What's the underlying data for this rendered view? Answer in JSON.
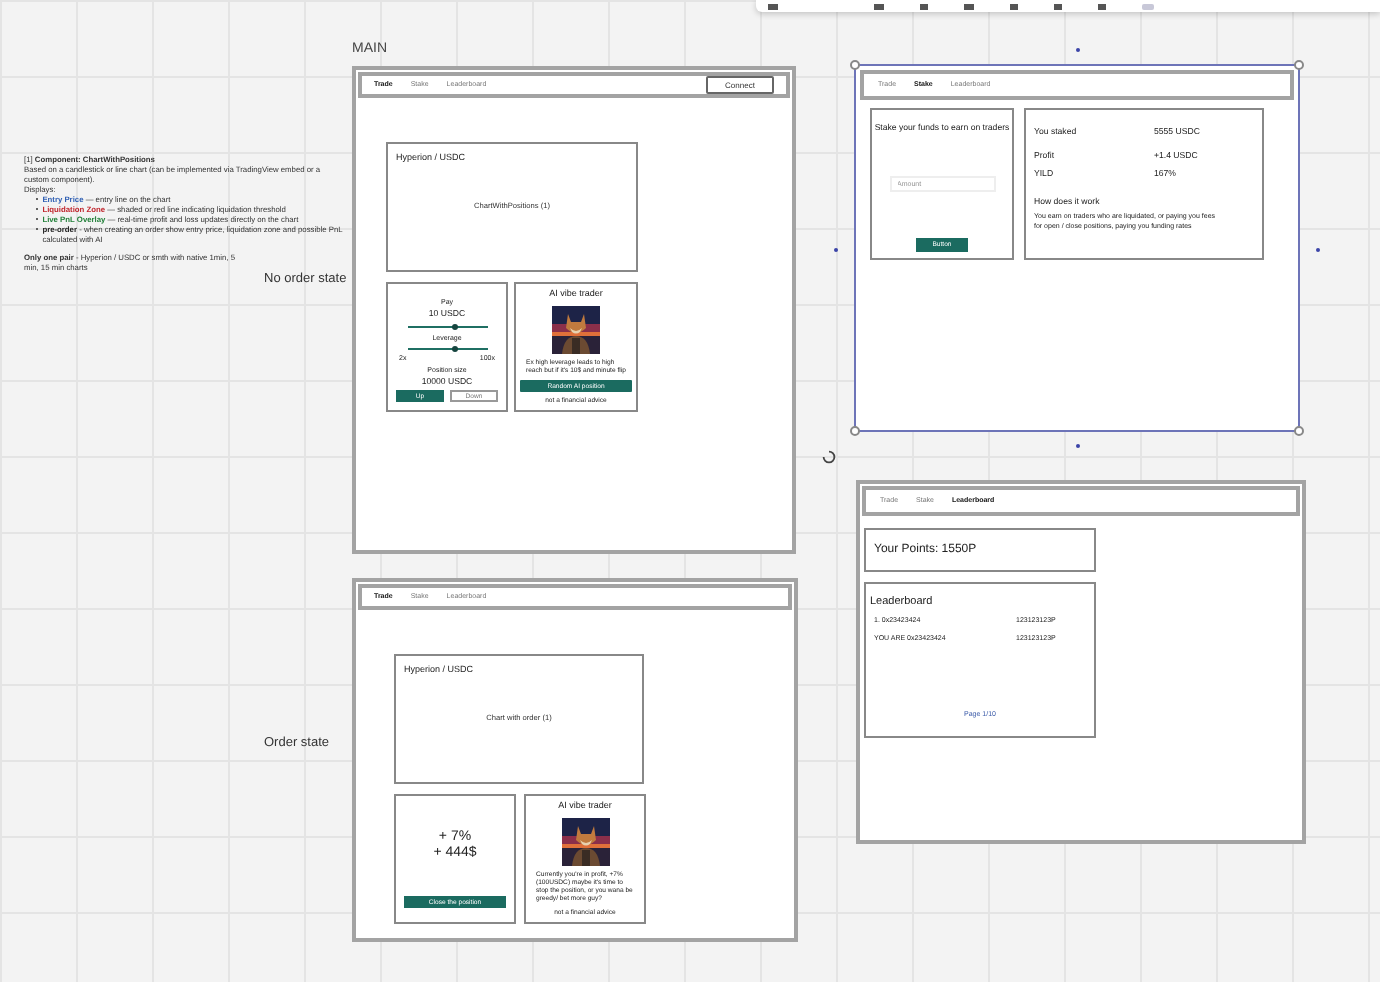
{
  "main_label": "MAIN",
  "notes": {
    "heading": "[1] **Component: ChartWithPositions**",
    "intro": "Based on a candlestick or line chart (can be implemented via TradingView embed or a custom component).",
    "displays_label": "Displays:",
    "bullets": [
      {
        "term": "Entry Price",
        "color": "#2f5fb3",
        "text": " — entry line on the chart"
      },
      {
        "term": "Liquidation Zone",
        "color": "#c0262d",
        "text": " — shaded or red line indicating liquidation threshold"
      },
      {
        "term": "Live PnL Overlay",
        "color": "#23803a",
        "text": " — real-time profit and loss updates directly on the chart"
      },
      {
        "term": "pre-order",
        "color": "#222222",
        "text": " - when creating an order show entry price, liquidation zone and possible PnL calculated with AI"
      }
    ],
    "footer": "**Only one pair** - Hyperion / USDC or smth with native 1min, 5 min, 15 min charts"
  },
  "state_labels": [
    "No order state",
    "Order state"
  ],
  "frames": [
    {
      "kind": "trade",
      "tabs": [
        {
          "label": "Trade",
          "selected": true
        },
        {
          "label": "Stake",
          "selected": false
        },
        {
          "label": "Leaderboard",
          "selected": false
        }
      ],
      "connect": "Connect",
      "chart": {
        "title": "Hyperion / USDC",
        "caption": "ChartWithPositions (1)"
      },
      "trade_panel": {
        "pay_label": "Pay",
        "pay_value": "10 USDC",
        "pay_slider": {
          "level": 0.6
        },
        "leverage_label": "Leverage",
        "leverage_slider": {
          "level": 0.6
        },
        "leverage_min": "2x",
        "leverage_max": "100x",
        "size_label": "Position size",
        "size_value": "10000 USDC",
        "buttons": [
          {
            "label": "Up",
            "kind": "primary"
          },
          {
            "label": "Down",
            "kind": "secondary"
          }
        ]
      },
      "ai": {
        "title": "AI vibe trader",
        "message": "Ex high leverage leads to high reach but if it's 10$ and minute flip",
        "button": "Random AI position",
        "disclaimer": "not a financial advice"
      }
    },
    {
      "kind": "stake",
      "tabs": [
        {
          "label": "Trade",
          "selected": false
        },
        {
          "label": "Stake",
          "selected": true
        },
        {
          "label": "Leaderboard",
          "selected": false
        }
      ],
      "stake_panel": {
        "title": "Stake your funds to earn on traders",
        "placeholder": "Amount",
        "button": "Button"
      },
      "stats": [
        {
          "label": "You staked",
          "value": "5555 USDC"
        },
        {
          "label": "Profit",
          "value": "+1.4 USDC"
        },
        {
          "label": "YILD",
          "value": "167%"
        }
      ],
      "how_title": "How does it work",
      "how_lines": [
        "You earn on traders who are liquidated, or paying you fees",
        "for open / close positions, paying you funding rates"
      ]
    },
    {
      "kind": "leaderboard",
      "tabs": [
        {
          "label": "Trade",
          "selected": false
        },
        {
          "label": "Stake",
          "selected": false
        },
        {
          "label": "Leaderboard",
          "selected": true
        }
      ],
      "points": "Your Points: 1550P",
      "board_title": "Leaderboard",
      "rows": [
        {
          "name": "1. 0x23423424",
          "score": "123123123P"
        },
        {
          "name": "YOU ARE 0x23423424",
          "score": "123123123P"
        }
      ],
      "page": "Page 1/10"
    },
    {
      "kind": "order",
      "tabs": [
        {
          "label": "Trade",
          "selected": true
        },
        {
          "label": "Stake",
          "selected": false
        },
        {
          "label": "Leaderboard",
          "selected": false
        }
      ],
      "chart": {
        "title": "Hyperion / USDC",
        "caption": "Chart with order (1)"
      },
      "pnl": {
        "percent": "+ 7%",
        "amount": "+ 444$",
        "button": "Close the position"
      },
      "ai": {
        "title": "AI vibe trader",
        "message": "Currently you're in profit, +7% (100USDC) maybe it's time to stop the position, or you wana be greedy/ bet more guy?",
        "disclaimer": "not a financial advice"
      }
    }
  ]
}
